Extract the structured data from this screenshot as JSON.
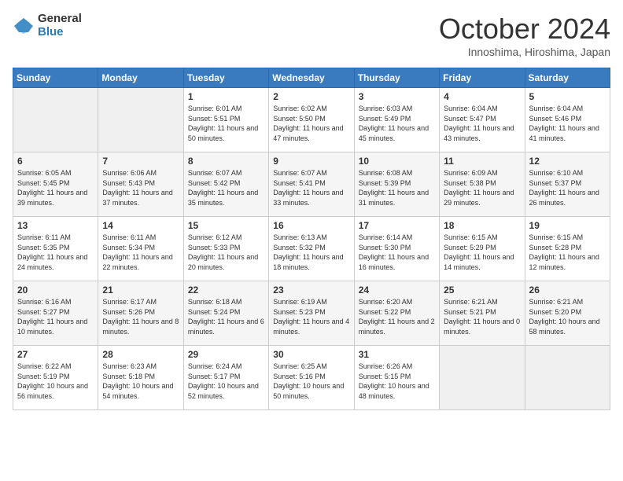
{
  "logo": {
    "general": "General",
    "blue": "Blue"
  },
  "title": "October 2024",
  "subtitle": "Innoshima, Hiroshima, Japan",
  "days_of_week": [
    "Sunday",
    "Monday",
    "Tuesday",
    "Wednesday",
    "Thursday",
    "Friday",
    "Saturday"
  ],
  "weeks": [
    [
      {
        "day": "",
        "sunrise": "",
        "sunset": "",
        "daylight": "",
        "empty": true
      },
      {
        "day": "",
        "sunrise": "",
        "sunset": "",
        "daylight": "",
        "empty": true
      },
      {
        "day": "1",
        "sunrise": "Sunrise: 6:01 AM",
        "sunset": "Sunset: 5:51 PM",
        "daylight": "Daylight: 11 hours and 50 minutes."
      },
      {
        "day": "2",
        "sunrise": "Sunrise: 6:02 AM",
        "sunset": "Sunset: 5:50 PM",
        "daylight": "Daylight: 11 hours and 47 minutes."
      },
      {
        "day": "3",
        "sunrise": "Sunrise: 6:03 AM",
        "sunset": "Sunset: 5:49 PM",
        "daylight": "Daylight: 11 hours and 45 minutes."
      },
      {
        "day": "4",
        "sunrise": "Sunrise: 6:04 AM",
        "sunset": "Sunset: 5:47 PM",
        "daylight": "Daylight: 11 hours and 43 minutes."
      },
      {
        "day": "5",
        "sunrise": "Sunrise: 6:04 AM",
        "sunset": "Sunset: 5:46 PM",
        "daylight": "Daylight: 11 hours and 41 minutes."
      }
    ],
    [
      {
        "day": "6",
        "sunrise": "Sunrise: 6:05 AM",
        "sunset": "Sunset: 5:45 PM",
        "daylight": "Daylight: 11 hours and 39 minutes."
      },
      {
        "day": "7",
        "sunrise": "Sunrise: 6:06 AM",
        "sunset": "Sunset: 5:43 PM",
        "daylight": "Daylight: 11 hours and 37 minutes."
      },
      {
        "day": "8",
        "sunrise": "Sunrise: 6:07 AM",
        "sunset": "Sunset: 5:42 PM",
        "daylight": "Daylight: 11 hours and 35 minutes."
      },
      {
        "day": "9",
        "sunrise": "Sunrise: 6:07 AM",
        "sunset": "Sunset: 5:41 PM",
        "daylight": "Daylight: 11 hours and 33 minutes."
      },
      {
        "day": "10",
        "sunrise": "Sunrise: 6:08 AM",
        "sunset": "Sunset: 5:39 PM",
        "daylight": "Daylight: 11 hours and 31 minutes."
      },
      {
        "day": "11",
        "sunrise": "Sunrise: 6:09 AM",
        "sunset": "Sunset: 5:38 PM",
        "daylight": "Daylight: 11 hours and 29 minutes."
      },
      {
        "day": "12",
        "sunrise": "Sunrise: 6:10 AM",
        "sunset": "Sunset: 5:37 PM",
        "daylight": "Daylight: 11 hours and 26 minutes."
      }
    ],
    [
      {
        "day": "13",
        "sunrise": "Sunrise: 6:11 AM",
        "sunset": "Sunset: 5:35 PM",
        "daylight": "Daylight: 11 hours and 24 minutes."
      },
      {
        "day": "14",
        "sunrise": "Sunrise: 6:11 AM",
        "sunset": "Sunset: 5:34 PM",
        "daylight": "Daylight: 11 hours and 22 minutes."
      },
      {
        "day": "15",
        "sunrise": "Sunrise: 6:12 AM",
        "sunset": "Sunset: 5:33 PM",
        "daylight": "Daylight: 11 hours and 20 minutes."
      },
      {
        "day": "16",
        "sunrise": "Sunrise: 6:13 AM",
        "sunset": "Sunset: 5:32 PM",
        "daylight": "Daylight: 11 hours and 18 minutes."
      },
      {
        "day": "17",
        "sunrise": "Sunrise: 6:14 AM",
        "sunset": "Sunset: 5:30 PM",
        "daylight": "Daylight: 11 hours and 16 minutes."
      },
      {
        "day": "18",
        "sunrise": "Sunrise: 6:15 AM",
        "sunset": "Sunset: 5:29 PM",
        "daylight": "Daylight: 11 hours and 14 minutes."
      },
      {
        "day": "19",
        "sunrise": "Sunrise: 6:15 AM",
        "sunset": "Sunset: 5:28 PM",
        "daylight": "Daylight: 11 hours and 12 minutes."
      }
    ],
    [
      {
        "day": "20",
        "sunrise": "Sunrise: 6:16 AM",
        "sunset": "Sunset: 5:27 PM",
        "daylight": "Daylight: 11 hours and 10 minutes."
      },
      {
        "day": "21",
        "sunrise": "Sunrise: 6:17 AM",
        "sunset": "Sunset: 5:26 PM",
        "daylight": "Daylight: 11 hours and 8 minutes."
      },
      {
        "day": "22",
        "sunrise": "Sunrise: 6:18 AM",
        "sunset": "Sunset: 5:24 PM",
        "daylight": "Daylight: 11 hours and 6 minutes."
      },
      {
        "day": "23",
        "sunrise": "Sunrise: 6:19 AM",
        "sunset": "Sunset: 5:23 PM",
        "daylight": "Daylight: 11 hours and 4 minutes."
      },
      {
        "day": "24",
        "sunrise": "Sunrise: 6:20 AM",
        "sunset": "Sunset: 5:22 PM",
        "daylight": "Daylight: 11 hours and 2 minutes."
      },
      {
        "day": "25",
        "sunrise": "Sunrise: 6:21 AM",
        "sunset": "Sunset: 5:21 PM",
        "daylight": "Daylight: 11 hours and 0 minutes."
      },
      {
        "day": "26",
        "sunrise": "Sunrise: 6:21 AM",
        "sunset": "Sunset: 5:20 PM",
        "daylight": "Daylight: 10 hours and 58 minutes."
      }
    ],
    [
      {
        "day": "27",
        "sunrise": "Sunrise: 6:22 AM",
        "sunset": "Sunset: 5:19 PM",
        "daylight": "Daylight: 10 hours and 56 minutes."
      },
      {
        "day": "28",
        "sunrise": "Sunrise: 6:23 AM",
        "sunset": "Sunset: 5:18 PM",
        "daylight": "Daylight: 10 hours and 54 minutes."
      },
      {
        "day": "29",
        "sunrise": "Sunrise: 6:24 AM",
        "sunset": "Sunset: 5:17 PM",
        "daylight": "Daylight: 10 hours and 52 minutes."
      },
      {
        "day": "30",
        "sunrise": "Sunrise: 6:25 AM",
        "sunset": "Sunset: 5:16 PM",
        "daylight": "Daylight: 10 hours and 50 minutes."
      },
      {
        "day": "31",
        "sunrise": "Sunrise: 6:26 AM",
        "sunset": "Sunset: 5:15 PM",
        "daylight": "Daylight: 10 hours and 48 minutes."
      },
      {
        "day": "",
        "sunrise": "",
        "sunset": "",
        "daylight": "",
        "empty": true
      },
      {
        "day": "",
        "sunrise": "",
        "sunset": "",
        "daylight": "",
        "empty": true
      }
    ]
  ]
}
